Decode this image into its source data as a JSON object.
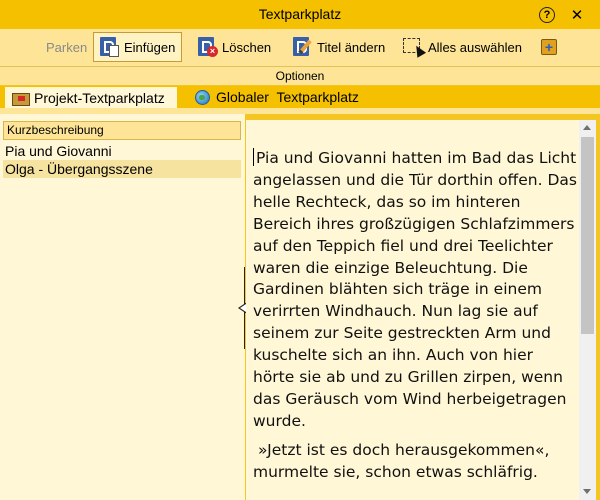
{
  "window": {
    "title": "Textparkplatz",
    "help_symbol": "?",
    "close_symbol": "✕"
  },
  "toolbar": {
    "parken_label": "Parken",
    "einfuegen_label": "Einfügen",
    "loeschen_label": "Löschen",
    "titel_aendern_label": "Titel ändern",
    "alles_auswaehlen_label": "Alles auswählen",
    "plus_symbol": "+",
    "group_label": "Optionen"
  },
  "tabs": [
    {
      "label": "Projekt-Textparkplatz",
      "icon": "folder-icon",
      "selected": true
    },
    {
      "label": "Globaler  Textparkplatz",
      "icon": "globe-icon",
      "selected": false
    }
  ],
  "list": {
    "header": "Kurzbeschreibung",
    "items": [
      "Pia und Giovanni",
      "Olga - Übergangsszene"
    ],
    "selected_index": 1
  },
  "editor": {
    "paragraphs": [
      "Pia und Giovanni hatten im Bad das Licht angelassen und die Tür dorthin offen. Das helle Rechteck, das so im hinteren Bereich ihres großzügigen Schlafzimmers auf den Teppich fiel und drei Teelichter waren die einzige Beleuchtung. Die Gardinen blähten sich träge in einem verirrten Windhauch. Nun lag sie auf seinem zur Seite gestreckten Arm und kuschelte sich an ihn. Auch von hier hörte sie ab und zu Grillen zirpen, wenn das Geräusch vom Wind herbeigetragen wurde.",
      "»Jetzt ist es doch herausgekommen«, murmelte sie, schon etwas schläfrig."
    ]
  },
  "colors": {
    "title_bar": "#f4c000",
    "ribbon": "#fde497",
    "pane": "#fff7d6",
    "selected_item": "#f6e3a0"
  }
}
